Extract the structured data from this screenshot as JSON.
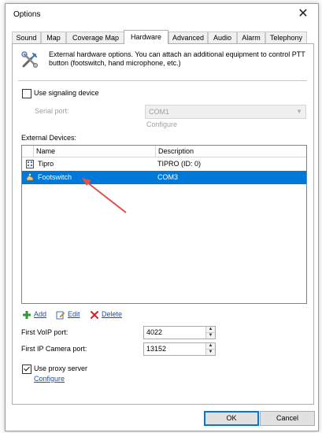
{
  "window": {
    "title": "Options",
    "close_glyph": "✕"
  },
  "tabs": [
    {
      "label": "Sound"
    },
    {
      "label": "Map"
    },
    {
      "label": "Coverage Map"
    },
    {
      "label": "Hardware"
    },
    {
      "label": "Advanced"
    },
    {
      "label": "Audio"
    },
    {
      "label": "Alarm"
    },
    {
      "label": "Telephony"
    }
  ],
  "active_tab": "Hardware",
  "header": {
    "icon": "tools-icon",
    "text": "External hardware options. You can attach an additional equipment to control PTT button (footswitch, hand microphone, etc.)"
  },
  "signaling": {
    "checkbox_label": "Use signaling device",
    "checked": false,
    "serial_port_label": "Serial port:",
    "serial_port_value": "COM1",
    "configure_label": "Configure"
  },
  "devices": {
    "section_label": "External Devices:",
    "columns": {
      "name": "Name",
      "description": "Description"
    },
    "rows": [
      {
        "name": "Tipro",
        "description": "TIPRO (ID: 0)",
        "icon": "keypad-icon",
        "selected": false
      },
      {
        "name": "Footswitch",
        "description": "COM3",
        "icon": "footswitch-icon",
        "selected": true
      }
    ]
  },
  "toolbar": {
    "add_label": "Add",
    "edit_label": "Edit",
    "delete_label": "Delete"
  },
  "ports": {
    "voip_label": "First VoIP port:",
    "voip_value": "4022",
    "camera_label": "First IP Camera port:",
    "camera_value": "13152"
  },
  "proxy": {
    "checkbox_label": "Use proxy server",
    "checked": true,
    "configure_label": "Configure"
  },
  "buttons": {
    "ok": "OK",
    "cancel": "Cancel"
  },
  "colors": {
    "selection": "#0078d7",
    "link": "#1a4fb5",
    "annotation_arrow": "#e0524a"
  }
}
